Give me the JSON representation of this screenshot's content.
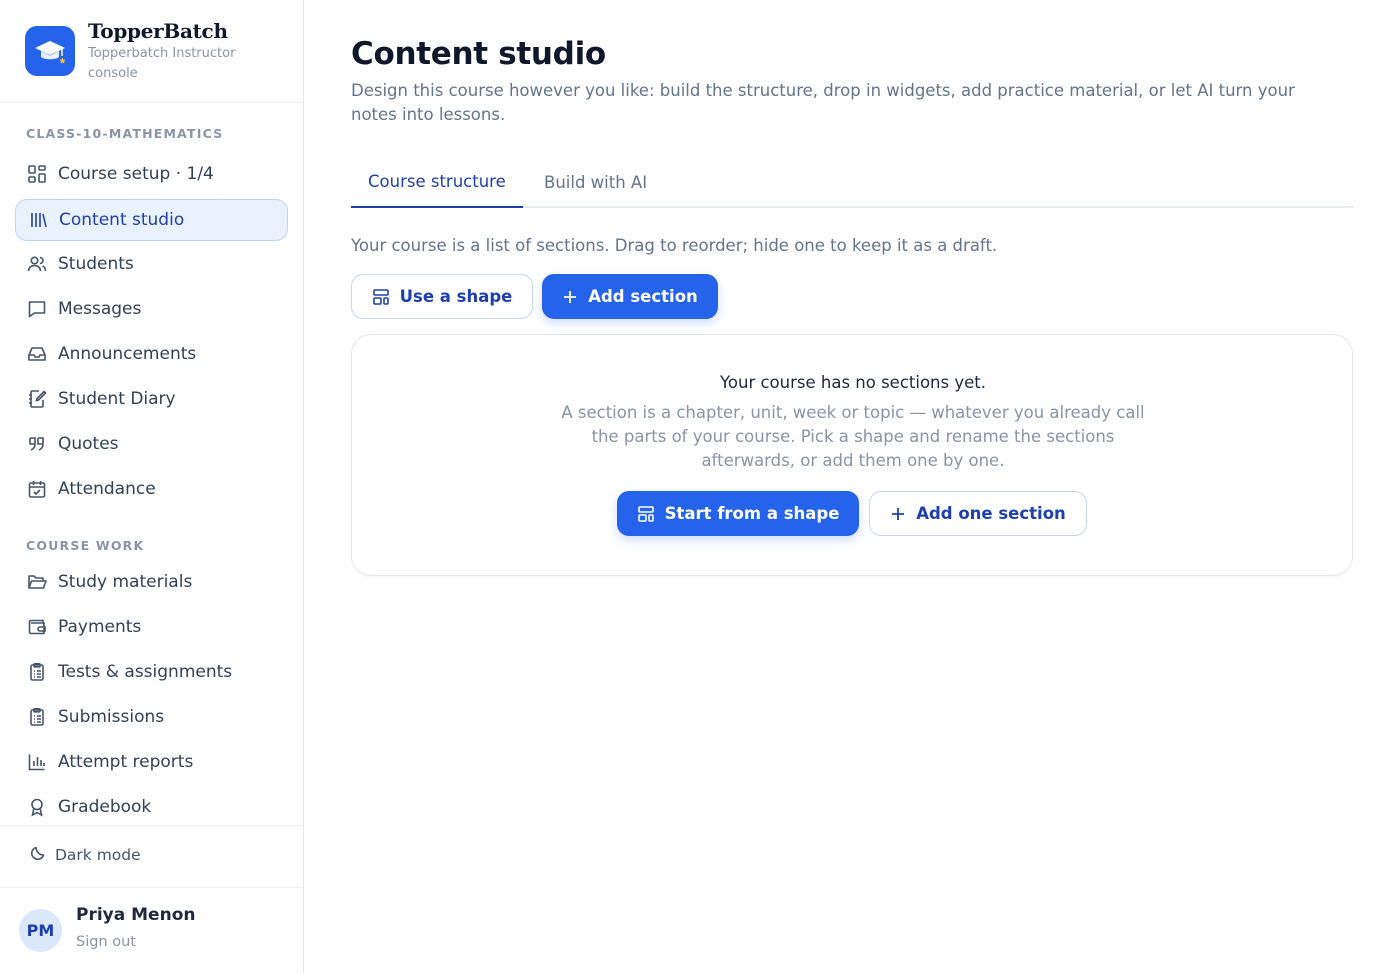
{
  "brand": {
    "name": "TopperBatch",
    "subtitle": "Topperbatch Instructor console"
  },
  "sidebar": {
    "course_label": "CLASS-10-MATHEMATICS",
    "course_items": [
      {
        "label": "Course setup · 1/4",
        "icon": "grid-icon"
      },
      {
        "label": "Content studio",
        "icon": "library-icon",
        "active": true
      },
      {
        "label": "Students",
        "icon": "users-icon"
      },
      {
        "label": "Messages",
        "icon": "message-icon"
      },
      {
        "label": "Announcements",
        "icon": "inbox-icon"
      },
      {
        "label": "Student Diary",
        "icon": "notebook-pen-icon"
      },
      {
        "label": "Quotes",
        "icon": "quote-icon"
      },
      {
        "label": "Attendance",
        "icon": "calendar-check-icon"
      }
    ],
    "work_label": "COURSE WORK",
    "work_items": [
      {
        "label": "Study materials",
        "icon": "folder-open-icon"
      },
      {
        "label": "Payments",
        "icon": "wallet-icon"
      },
      {
        "label": "Tests & assignments",
        "icon": "clipboard-list-icon"
      },
      {
        "label": "Submissions",
        "icon": "clipboard-list-icon"
      },
      {
        "label": "Attempt reports",
        "icon": "bar-chart-icon"
      },
      {
        "label": "Gradebook",
        "icon": "award-icon"
      }
    ],
    "dark_mode_label": "Dark mode"
  },
  "user": {
    "initials": "PM",
    "name": "Priya Menon",
    "sign_out": "Sign out"
  },
  "main": {
    "title": "Content studio",
    "description": "Design this course however you like: build the structure, drop in widgets, add practice material, or let AI turn your notes into lessons.",
    "tabs": [
      {
        "label": "Course structure",
        "active": true
      },
      {
        "label": "Build with AI",
        "active": false
      }
    ],
    "helper_text": "Your course is a list of sections. Drag to reorder; hide one to keep it as a draft.",
    "use_shape_label": "Use a shape",
    "add_section_label": "Add section",
    "empty": {
      "title": "Your course has no sections yet.",
      "description": "A section is a chapter, unit, week or topic — whatever you already call the parts of your course. Pick a shape and rename the sections afterwards, or add them one by one.",
      "start_label": "Start from a shape",
      "add_one_label": "Add one section"
    }
  },
  "colors": {
    "accent": "#2563eb",
    "accent_dark": "#1e40af",
    "active_bg": "#eaf1ff"
  }
}
